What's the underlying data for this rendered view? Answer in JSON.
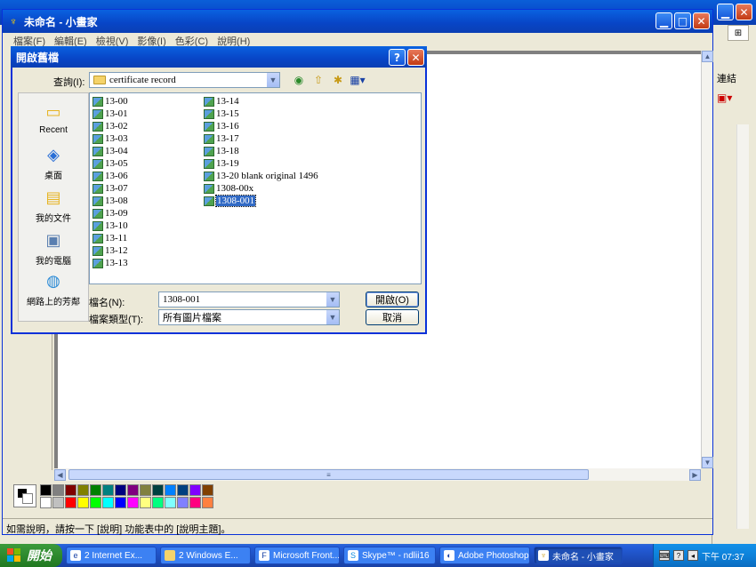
{
  "bg_window": {
    "right_label": "連結"
  },
  "paint": {
    "title": "未命名 - 小畫家",
    "menu": [
      "檔案(F)",
      "編輯(E)",
      "檢視(V)",
      "影像(I)",
      "色彩(C)",
      "說明(H)"
    ],
    "status_text": "如需說明，請按一下 [說明] 功能表中的 [說明主題]。",
    "palette_top": [
      "#000000",
      "#808080",
      "#800000",
      "#808000",
      "#008000",
      "#008080",
      "#000080",
      "#800080",
      "#808040",
      "#004040",
      "#0080ff",
      "#004080",
      "#8000ff",
      "#804000"
    ],
    "palette_bottom": [
      "#ffffff",
      "#c0c0c0",
      "#ff0000",
      "#ffff00",
      "#00ff00",
      "#00ffff",
      "#0000ff",
      "#ff00ff",
      "#ffff80",
      "#00ff80",
      "#80ffff",
      "#8080ff",
      "#ff0080",
      "#ff8040"
    ]
  },
  "dialog": {
    "title": "開啟舊檔",
    "look_in_label": "查詢(I):",
    "look_in_value": "certificate record",
    "places": [
      {
        "label": "Recent",
        "icon": "recent-folder-icon"
      },
      {
        "label": "桌面",
        "icon": "desktop-icon"
      },
      {
        "label": "我的文件",
        "icon": "my-documents-icon"
      },
      {
        "label": "我的電腦",
        "icon": "my-computer-icon"
      },
      {
        "label": "網路上的芳鄰",
        "icon": "network-places-icon"
      }
    ],
    "files_col1": [
      "13-00",
      "13-01",
      "13-02",
      "13-03",
      "13-04",
      "13-05",
      "13-06",
      "13-07",
      "13-08",
      "13-09",
      "13-10",
      "13-11",
      "13-12",
      "13-13"
    ],
    "files_col2": [
      "13-14",
      "13-15",
      "13-16",
      "13-17",
      "13-18",
      "13-19",
      "13-20 blank original 1496",
      "1308-00x",
      "1308-001"
    ],
    "selected_file": "1308-001",
    "filename_label": "檔名(N):",
    "filename_value": "1308-001",
    "filetype_label": "檔案類型(T):",
    "filetype_value": "所有圖片檔案",
    "open_button": "開啟(O)",
    "cancel_button": "取消"
  },
  "taskbar": {
    "start_label": "開始",
    "tasks": [
      {
        "label": "2 Internet Ex...",
        "icon": "ie-icon"
      },
      {
        "label": "2 Windows E...",
        "icon": "folder-icon"
      },
      {
        "label": "Microsoft Front...",
        "icon": "frontpage-icon"
      },
      {
        "label": "Skype™ - ndlii16",
        "icon": "skype-icon"
      },
      {
        "label": "Adobe Photoshop",
        "icon": "photoshop-icon"
      },
      {
        "label": "未命名 - 小畫家",
        "icon": "paint-icon",
        "active": true
      }
    ],
    "clock": "下午 07:37"
  }
}
